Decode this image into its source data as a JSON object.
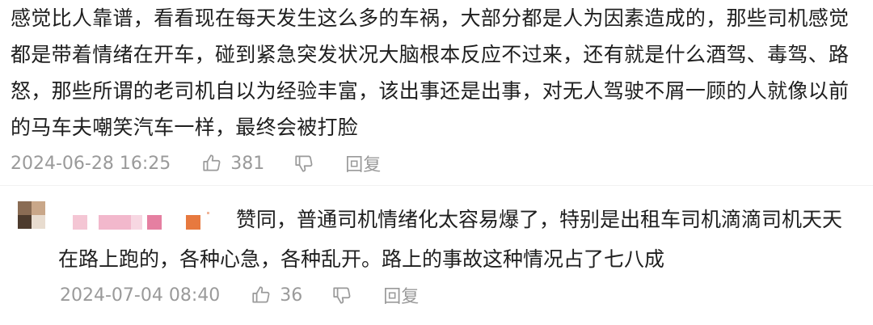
{
  "main_comment": {
    "text": "感觉比人靠谱，看看现在每天发生这么多的车祸，大部分都是人为因素造成的，那些司机感觉都是带着情绪在开车，碰到紧急突发状况大脑根本反应不过来，还有就是什么酒驾、毒驾、路怒，那些所谓的老司机自以为经验丰富，该出事还是出事，对无人驾驶不屑一顾的人就像以前的马车夫嘲笑汽车一样，最终会被打脸",
    "timestamp": "2024-06-28 16:25",
    "likes": "381",
    "reply_label": "回复"
  },
  "reply_comment": {
    "text": "赞同，普通司机情绪化太容易爆了，特别是出租车司机滴滴司机天天在路上跑的，各种心急，各种乱开。路上的事故这种情况占了七八成",
    "timestamp": "2024-07-04 08:40",
    "likes": "36",
    "reply_label": "回复"
  },
  "icons": {
    "like": "thumbs-up-icon",
    "dislike": "thumbs-down-icon"
  },
  "colors": {
    "meta_text": "#9a9a9a",
    "body_text": "#1f1f1f"
  }
}
